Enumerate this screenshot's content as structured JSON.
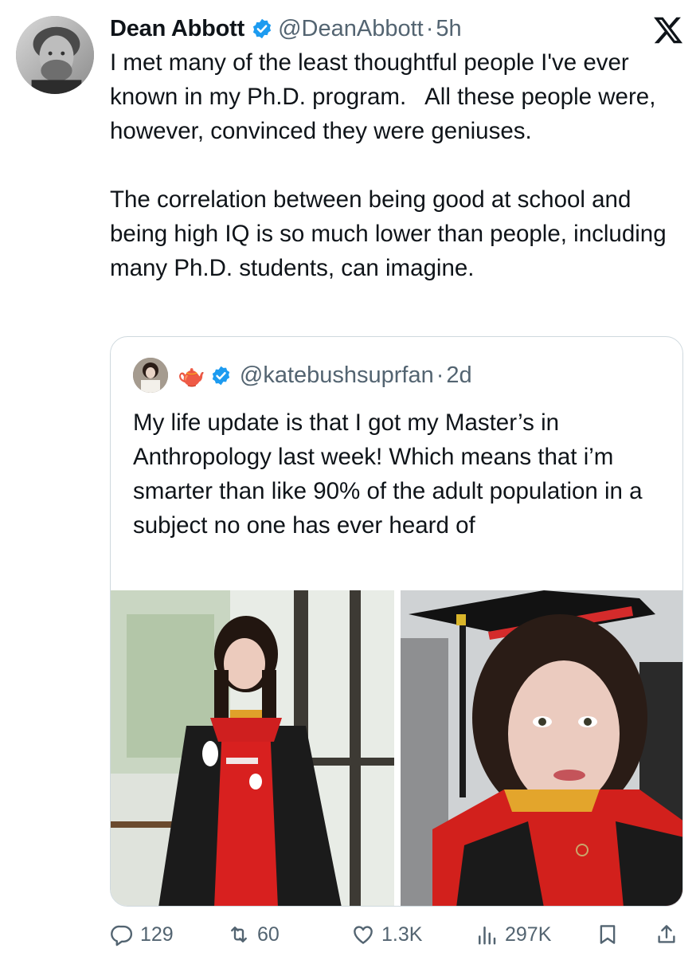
{
  "tweet": {
    "author": {
      "display_name": "Dean Abbott",
      "handle": "@DeanAbbott",
      "time": "5h",
      "avatar_icon": "profile-photo",
      "verified": true
    },
    "separator": "·",
    "text": "I met many of the least thoughtful people I've ever known in my Ph.D. program.   All these people were, however, convinced they were geniuses.\n\nThe correlation between being good at school and being high IQ is so much lower than people, including many Ph.D. students, can imagine."
  },
  "quoted_tweet": {
    "author": {
      "display_name": "🫖",
      "handle": "@katebushsuprfan",
      "time": "2d",
      "verified": true
    },
    "separator": "·",
    "text": "My life update is that I got my Master’s in Anthropology last week! Which means that i’m smarter than like 90% of the adult population in a subject no one has ever heard of",
    "media": [
      {
        "description_icon": "graduation-photo-full-length"
      },
      {
        "description_icon": "graduation-selfie"
      }
    ]
  },
  "actions": {
    "reply_count": "129",
    "retweet_count": "60",
    "like_count": "1.3K",
    "view_count": "297K"
  },
  "colors": {
    "text": "#0f1419",
    "secondary": "#536471",
    "verified_blue": "#1d9bf0",
    "border": "#cfd9de"
  }
}
